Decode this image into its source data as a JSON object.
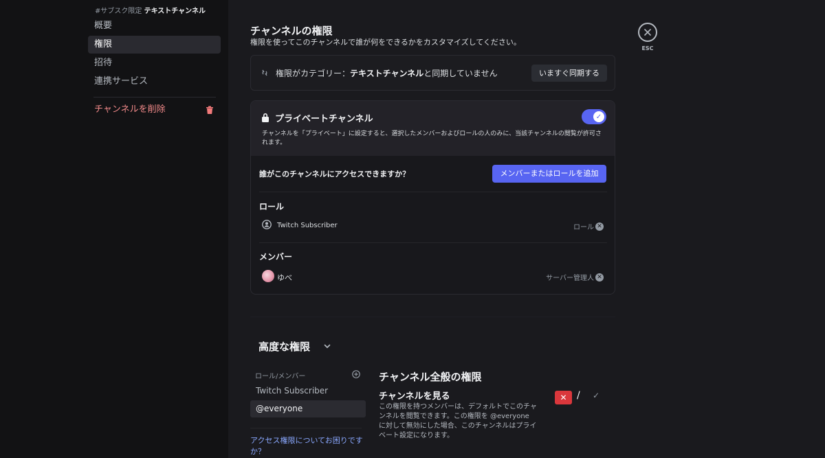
{
  "sidebar": {
    "header_prefix": "#サブスク限定",
    "header_channel": "テキストチャンネル",
    "items": [
      {
        "label": "概要"
      },
      {
        "label": "権限"
      },
      {
        "label": "招待"
      },
      {
        "label": "連携サービス"
      }
    ],
    "delete_label": "チャンネルを削除"
  },
  "header": {
    "title": "チャンネルの権限",
    "subtitle": "権限を使ってこのチャンネルで誰が何をできるかをカスタマイズしてください。",
    "close_label": "ESC"
  },
  "sync": {
    "text_before": "権限がカテゴリー：",
    "category": "テキストチャンネル",
    "text_after": "と同期していません",
    "button": "いますぐ同期する"
  },
  "private": {
    "title": "プライベートチャンネル",
    "toggle_on": true,
    "description": "チャンネルを「プライベート」に設定すると、選択したメンバーおよびロールの人のみに、当該チャンネルの閲覧が許可されます。",
    "who_access": "誰がこのチャンネルにアクセスできますか？",
    "add_button": "メンバーまたはロールを追加",
    "roles_label": "ロール",
    "roles": [
      {
        "name": "Twitch Subscriber",
        "tag": "ロール"
      }
    ],
    "members_label": "メンバー",
    "members": [
      {
        "name": "ゆべ",
        "tag": "サーバー管理人"
      }
    ]
  },
  "advanced": {
    "title": "高度な権限",
    "list_header": "ロール/メンバー",
    "list": [
      {
        "label": "Twitch Subscriber"
      },
      {
        "label": "@everyone"
      }
    ],
    "help_link": "アクセス権限についてお困りですか？",
    "perm_section_title": "チャンネル全般の権限",
    "perm_name": "チャンネルを見る",
    "perm_desc": "この権限を持つメンバーは、デフォルトでこのチャンネルを閲覧できます。この権限を @everyone に対して無効にした場合、このチャンネルはプライベート設定になります。"
  },
  "colors": {
    "accent": "#5865f2",
    "danger": "#da373c",
    "link": "#8aa8ff"
  }
}
